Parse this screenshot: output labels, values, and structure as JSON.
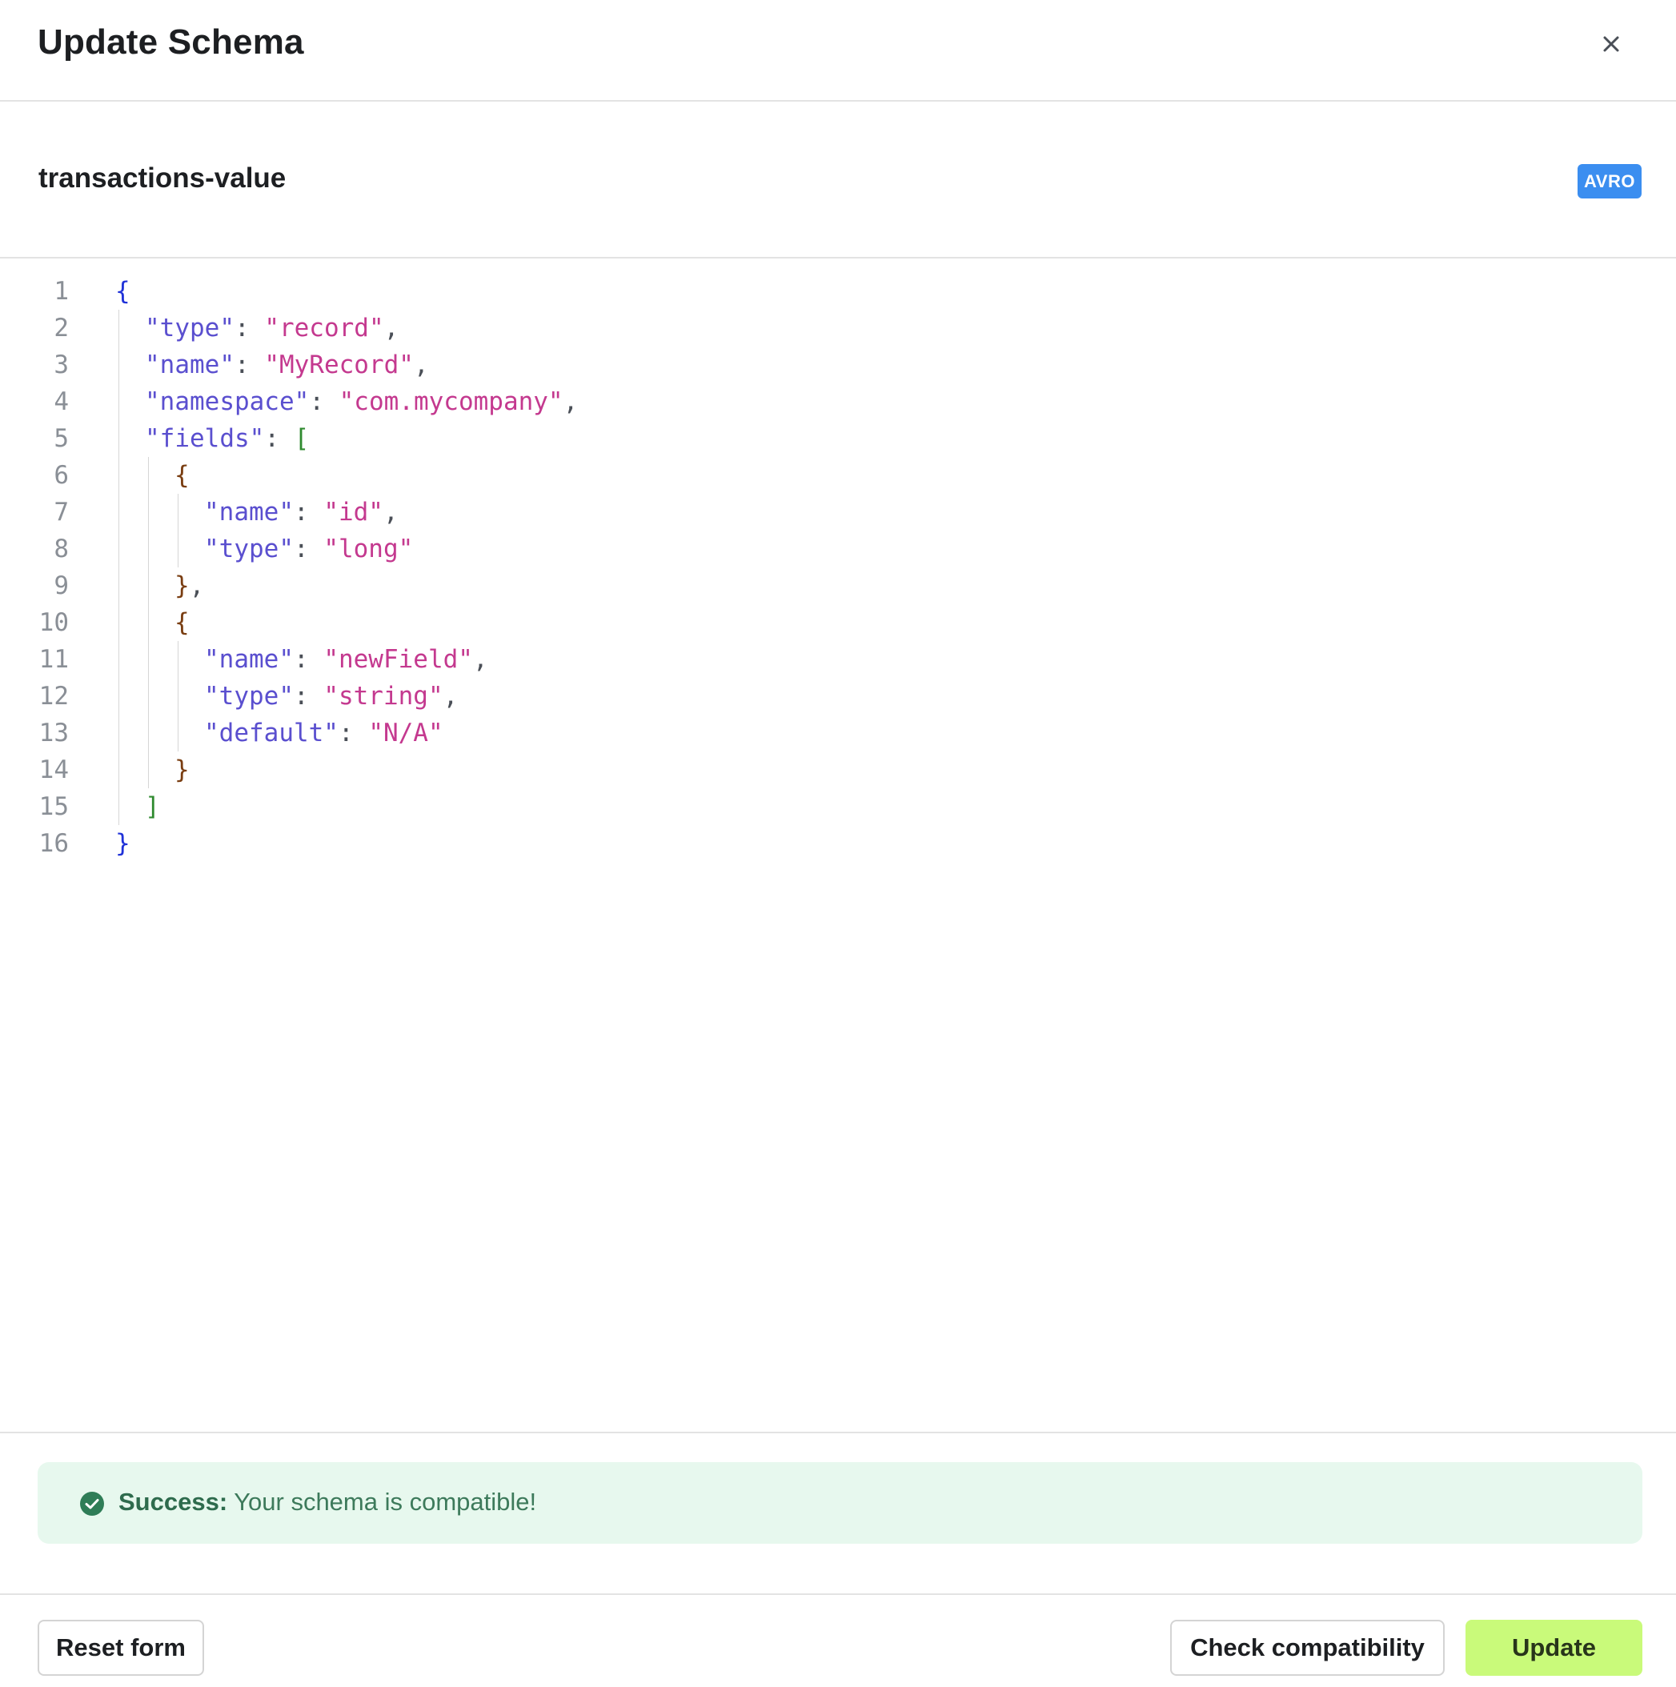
{
  "dialog": {
    "title": "Update Schema",
    "close_icon": "close-icon"
  },
  "subject": {
    "name": "transactions-value",
    "format": "AVRO",
    "format_color": "#3b8ef0"
  },
  "editor": {
    "line_numbers": [
      "1",
      "2",
      "3",
      "4",
      "5",
      "6",
      "7",
      "8",
      "9",
      "10",
      "11",
      "12",
      "13",
      "14",
      "15",
      "16"
    ],
    "lines": [
      [
        {
          "t": "{",
          "c": "b1"
        }
      ],
      [
        {
          "t": "\"type\"",
          "c": "key"
        },
        {
          "t": ": ",
          "c": "punc"
        },
        {
          "t": "\"record\"",
          "c": "str"
        },
        {
          "t": ",",
          "c": "punc"
        }
      ],
      [
        {
          "t": "\"name\"",
          "c": "key"
        },
        {
          "t": ": ",
          "c": "punc"
        },
        {
          "t": "\"MyRecord\"",
          "c": "str"
        },
        {
          "t": ",",
          "c": "punc"
        }
      ],
      [
        {
          "t": "\"namespace\"",
          "c": "key"
        },
        {
          "t": ": ",
          "c": "punc"
        },
        {
          "t": "\"com.mycompany\"",
          "c": "str"
        },
        {
          "t": ",",
          "c": "punc"
        }
      ],
      [
        {
          "t": "\"fields\"",
          "c": "key"
        },
        {
          "t": ": ",
          "c": "punc"
        },
        {
          "t": "[",
          "c": "b2"
        }
      ],
      [
        {
          "t": "{",
          "c": "b3"
        }
      ],
      [
        {
          "t": "\"name\"",
          "c": "key"
        },
        {
          "t": ": ",
          "c": "punc"
        },
        {
          "t": "\"id\"",
          "c": "str"
        },
        {
          "t": ",",
          "c": "punc"
        }
      ],
      [
        {
          "t": "\"type\"",
          "c": "key"
        },
        {
          "t": ": ",
          "c": "punc"
        },
        {
          "t": "\"long\"",
          "c": "str"
        }
      ],
      [
        {
          "t": "}",
          "c": "b3"
        },
        {
          "t": ",",
          "c": "punc"
        }
      ],
      [
        {
          "t": "{",
          "c": "b3"
        }
      ],
      [
        {
          "t": "\"name\"",
          "c": "key"
        },
        {
          "t": ": ",
          "c": "punc"
        },
        {
          "t": "\"newField\"",
          "c": "str"
        },
        {
          "t": ",",
          "c": "punc"
        }
      ],
      [
        {
          "t": "\"type\"",
          "c": "key"
        },
        {
          "t": ": ",
          "c": "punc"
        },
        {
          "t": "\"string\"",
          "c": "str"
        },
        {
          "t": ",",
          "c": "punc"
        }
      ],
      [
        {
          "t": "\"default\"",
          "c": "key"
        },
        {
          "t": ": ",
          "c": "punc"
        },
        {
          "t": "\"N/A\"",
          "c": "str"
        }
      ],
      [
        {
          "t": "}",
          "c": "b3"
        }
      ],
      [
        {
          "t": "]",
          "c": "b2"
        }
      ],
      [
        {
          "t": "}",
          "c": "b1"
        }
      ]
    ]
  },
  "alert": {
    "icon": "check-circle-icon",
    "label": "Success:",
    "message": " Your schema is compatible!",
    "background": "#e7f8ee",
    "color": "#3d7a5b"
  },
  "footer": {
    "reset_label": "Reset form",
    "check_label": "Check compatibility",
    "update_label": "Update",
    "update_color": "#c9fa7a"
  }
}
